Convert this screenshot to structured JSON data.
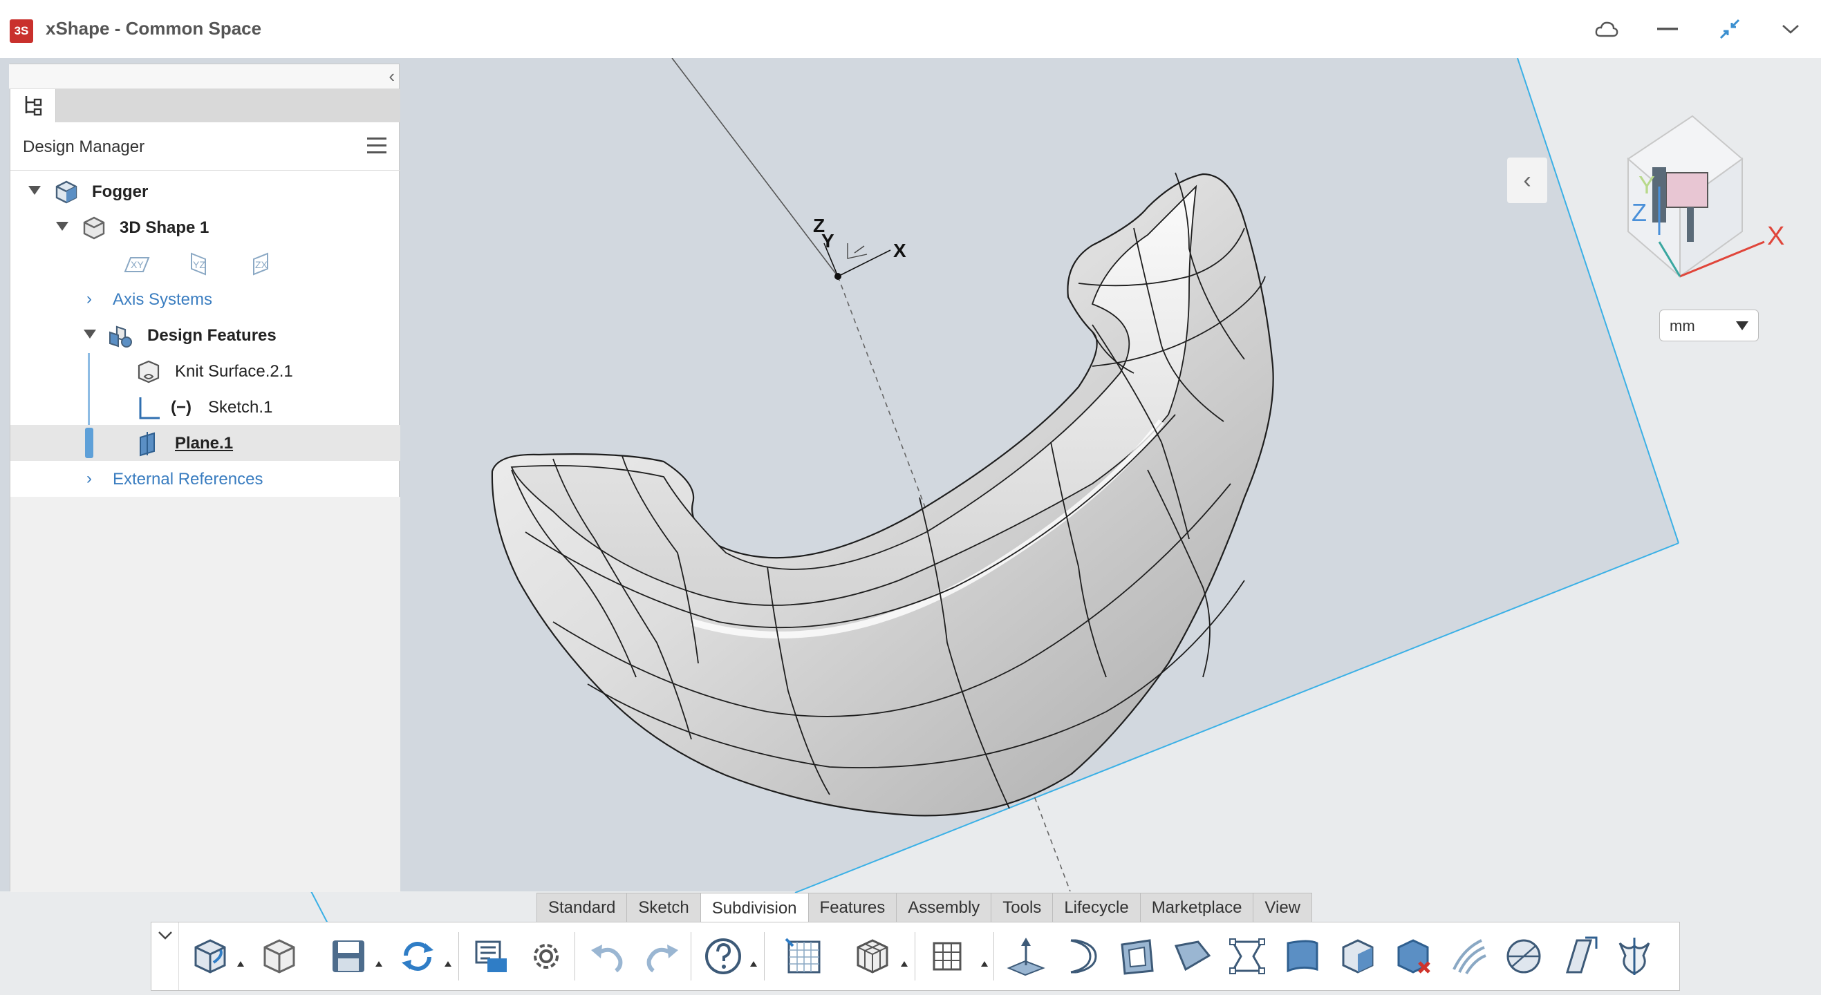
{
  "window": {
    "title": "xShape - Common Space",
    "logo_text": "3S",
    "colors": {
      "logo": "#c9302c",
      "accent": "#3a7dc0",
      "selection_bar": "#5ea0d8",
      "plane_edge": "#3ab0e6"
    }
  },
  "title_controls": [
    {
      "name": "cloud-icon"
    },
    {
      "name": "minimize-icon"
    },
    {
      "name": "compact-icon"
    },
    {
      "name": "chevron-down-icon"
    }
  ],
  "design_manager": {
    "title": "Design Manager",
    "tree": [
      {
        "label": "Fogger",
        "style": "bold",
        "expanded": true
      },
      {
        "label": "3D Shape 1",
        "style": "bold",
        "expanded": true
      },
      {
        "planes": [
          "XY",
          "YZ",
          "ZX"
        ]
      },
      {
        "label": "Axis Systems",
        "style": "link",
        "expanded": false
      },
      {
        "label": "Design Features",
        "style": "bold",
        "expanded": true
      },
      {
        "label": "Knit Surface.2.1",
        "style": "normal"
      },
      {
        "label": "Sketch.1",
        "prefix": "(−)",
        "style": "normal"
      },
      {
        "label": "Plane.1",
        "style": "selected"
      },
      {
        "label": "External References",
        "style": "link",
        "expanded": false
      }
    ]
  },
  "viewport": {
    "axes": {
      "z": "Z",
      "y": "Y",
      "x": "X"
    },
    "compass": {
      "x": "X",
      "y": "Y",
      "z": "Z"
    },
    "unit": "mm"
  },
  "action_bar": {
    "tabs": [
      "Standard",
      "Sketch",
      "Subdivision",
      "Features",
      "Assembly",
      "Tools",
      "Lifecycle",
      "Marketplace",
      "View"
    ],
    "active_tab": "Subdivision",
    "tools": [
      "new-shape-icon",
      "open-shape-icon",
      "save-icon",
      "refresh-icon",
      "properties-icon",
      "settings-gear-icon",
      "undo-icon",
      "redo-icon",
      "help-icon",
      "display-grid-icon",
      "subdivision-box-icon",
      "mesh-grid-icon",
      "extrude-face-icon",
      "cylinder-surface-icon",
      "face-inset-icon",
      "bend-face-icon",
      "edge-cage-icon",
      "thicken-icon",
      "box-select-icon",
      "delete-cage-icon",
      "curve-lines-icon",
      "sphere-icon",
      "plane-skew-icon",
      "symmetry-icon"
    ]
  }
}
